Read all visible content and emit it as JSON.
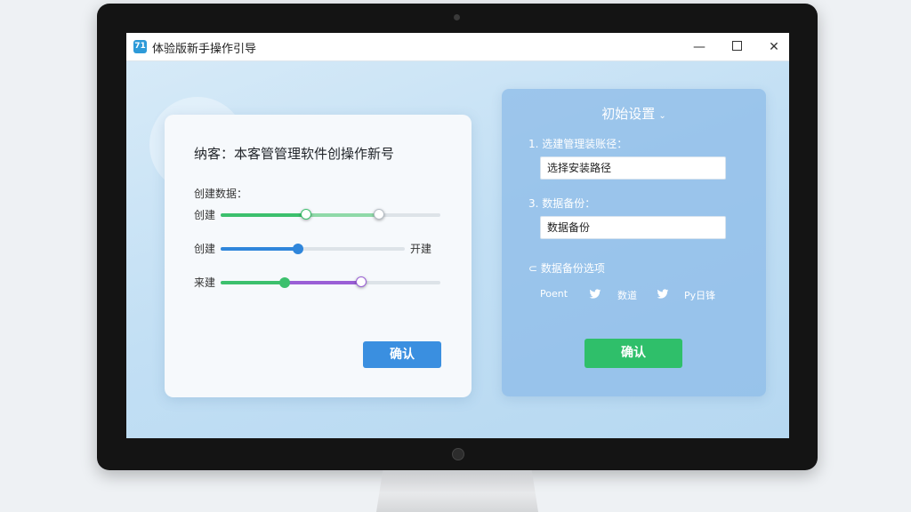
{
  "window": {
    "title": "体验版新手操作引导",
    "icon_glyph": "71",
    "minimize_glyph": "—",
    "close_glyph": "✕"
  },
  "left_card": {
    "heading": "纳客：本客管管理软件创操作新号",
    "section_label": "创建数据：",
    "sliders": [
      {
        "label": "创建",
        "end_label": "",
        "value": 0.39,
        "secondary_value": 0.72
      },
      {
        "label": "创建",
        "end_label": "开建",
        "value": 0.42
      },
      {
        "label": "来建",
        "end_label": "",
        "value": 0.29,
        "secondary_value": 0.64
      }
    ],
    "confirm_label": "确认"
  },
  "right_panel": {
    "title": "初始设置",
    "title_chevron": "⌄",
    "fields": [
      {
        "label": "1. 选建管理装账径：",
        "value": "选择安装路径"
      },
      {
        "label": "3. 数据备份：",
        "value": "数据备份"
      }
    ],
    "backup_options_label": "⊂ 数据备份选项",
    "backup_options": [
      "Poent",
      "数道",
      "Py日锋"
    ],
    "confirm_label": "确认"
  },
  "colors": {
    "blue_accent": "#3a8fe0",
    "green_accent": "#2fbf6a",
    "purple_accent": "#9a5fd6",
    "slider_blue": "#2f86db",
    "slider_green": "#3cc06d"
  }
}
